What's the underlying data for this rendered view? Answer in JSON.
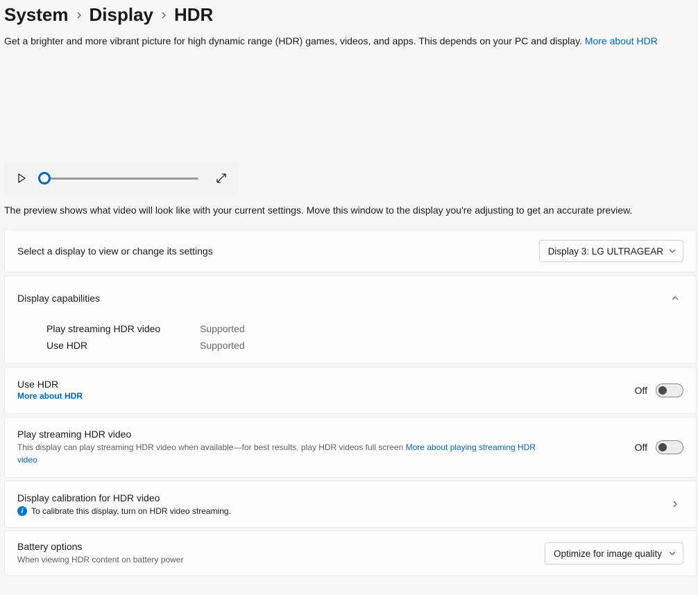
{
  "breadcrumb": {
    "level1": "System",
    "level2": "Display",
    "current": "HDR"
  },
  "intro": {
    "text": "Get a brighter and more vibrant picture for high dynamic range (HDR) games, videos, and apps. This depends on your PC and display. ",
    "link": "More about HDR"
  },
  "preview_caption": "The preview shows what video will look like with your current settings. Move this window to the display you're adjusting to get an accurate preview.",
  "display_select": {
    "label": "Select a display to view or change its settings",
    "value": "Display 3: LG ULTRAGEAR"
  },
  "capabilities": {
    "header": "Display capabilities",
    "rows": [
      {
        "label": "Play streaming HDR video",
        "value": "Supported"
      },
      {
        "label": "Use HDR",
        "value": "Supported"
      }
    ]
  },
  "use_hdr": {
    "title": "Use HDR",
    "link": "More about HDR",
    "state": "Off"
  },
  "play_streaming": {
    "title": "Play streaming HDR video",
    "desc": "This display can play streaming HDR video when available—for best results, play HDR videos full screen  ",
    "link": "More about playing streaming HDR video",
    "state": "Off"
  },
  "calibration": {
    "title": "Display calibration for HDR video",
    "note": "To calibrate this display, turn on HDR video streaming."
  },
  "battery": {
    "title": "Battery options",
    "desc": "When viewing HDR content on battery power",
    "value": "Optimize for image quality"
  }
}
